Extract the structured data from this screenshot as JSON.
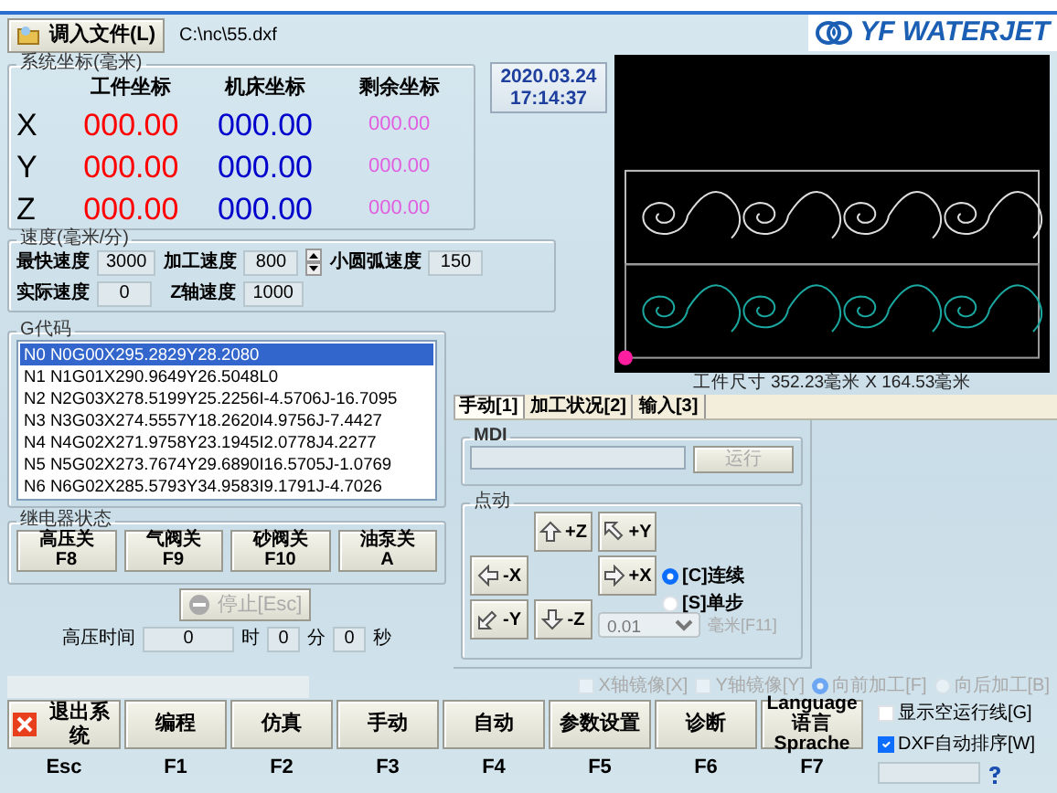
{
  "toolbar": {
    "load_button": "调入文件(L)",
    "file_path": "C:\\nc\\55.dxf"
  },
  "logo": {
    "text": "YF WATERJET"
  },
  "coordinates": {
    "title": "系统坐标(毫米)",
    "columns": [
      "工件坐标",
      "机床坐标",
      "剩余坐标"
    ],
    "rows": [
      {
        "axis": "X",
        "values": [
          "000.00",
          "000.00",
          "000.00"
        ]
      },
      {
        "axis": "Y",
        "values": [
          "000.00",
          "000.00",
          "000.00"
        ]
      },
      {
        "axis": "Z",
        "values": [
          "000.00",
          "000.00",
          "000.00"
        ]
      }
    ]
  },
  "datetime": {
    "date": "2020.03.24",
    "time": "17:14:37"
  },
  "preview": {
    "caption": "工件尺寸 352.23毫米 X 164.53毫米"
  },
  "speed": {
    "title": "速度(毫米/分)",
    "fields": [
      {
        "label": "最快速度",
        "value": "3000",
        "kind": "field"
      },
      {
        "label": "加工速度",
        "value": "800",
        "kind": "spinner"
      },
      {
        "label": "小圆弧速度",
        "value": "150",
        "kind": "field"
      },
      {
        "label": "实际速度",
        "value": "0",
        "kind": "field"
      },
      {
        "label": "Z轴速度",
        "value": "1000",
        "kind": "field"
      }
    ]
  },
  "gcode": {
    "title": "G代码",
    "lines": [
      {
        "text": "N0 N0G00X295.2829Y28.2080",
        "selected": true
      },
      {
        "text": "N1 N1G01X290.9649Y26.5048L0",
        "selected": false
      },
      {
        "text": "N2 N2G03X278.5199Y25.2256I-4.5706J-16.7095",
        "selected": false
      },
      {
        "text": "N3 N3G03X274.5557Y18.2620I4.9756J-7.4427",
        "selected": false
      },
      {
        "text": "N4 N4G02X271.9758Y23.1945I2.0778J4.2277",
        "selected": false
      },
      {
        "text": "N5 N5G02X273.7674Y29.6890I16.5705J-1.0769",
        "selected": false
      },
      {
        "text": "N6 N6G02X285.5793Y34.9583I9.1791J-4.7026",
        "selected": false
      }
    ]
  },
  "relays": {
    "title": "继电器状态",
    "buttons": [
      {
        "label": "高压关",
        "key": "F8"
      },
      {
        "label": "气阀关",
        "key": "F9"
      },
      {
        "label": "砂阀关",
        "key": "F10"
      },
      {
        "label": "油泵关",
        "key": "A"
      }
    ]
  },
  "stop_button": {
    "label": "停止[Esc]",
    "disabled": true
  },
  "pressure_time": {
    "label": "高压时间",
    "hours": "0",
    "hour_unit": "时",
    "minutes": "0",
    "minute_unit": "分",
    "seconds": "0",
    "second_unit": "秒"
  },
  "tabs": [
    {
      "label": "手动[1]",
      "selected": true
    },
    {
      "label": "加工状况[2]",
      "selected": false
    },
    {
      "label": "输入[3]",
      "selected": false
    }
  ],
  "mdi": {
    "title": "MDI",
    "run_button": "运行",
    "run_disabled": true
  },
  "jog": {
    "title": "点动",
    "buttons": [
      "+Z",
      "+Y",
      "-X",
      "+X",
      "-Y",
      "-Z"
    ],
    "modes": [
      {
        "label": "[C]连续",
        "selected": true
      },
      {
        "label": "[S]单步",
        "selected": false
      }
    ],
    "step": {
      "value": "0.01",
      "disabled": true
    },
    "unit": "毫米[F11]"
  },
  "options": [
    {
      "kind": "checkbox",
      "label": "X轴镜像[X]",
      "checked": false,
      "disabled": true
    },
    {
      "kind": "checkbox",
      "label": "Y轴镜像[Y]",
      "checked": false,
      "disabled": true
    },
    {
      "kind": "radio",
      "label": "向前加工[F]",
      "selected": true,
      "disabled": true
    },
    {
      "kind": "radio",
      "label": "向后加工[B]",
      "selected": false,
      "disabled": true
    }
  ],
  "side_options": [
    {
      "label": "显示空运行线[G]",
      "checked": false
    },
    {
      "label": "DXF自动排序[W]",
      "checked": true
    }
  ],
  "function_keys": [
    {
      "kind": "exit",
      "label": "退出系统",
      "key": "Esc"
    },
    {
      "kind": "plain",
      "label": "编程",
      "key": "F1"
    },
    {
      "kind": "plain",
      "label": "仿真",
      "key": "F2"
    },
    {
      "kind": "plain",
      "label": "手动",
      "key": "F3"
    },
    {
      "kind": "plain",
      "label": "自动",
      "key": "F4"
    },
    {
      "kind": "plain",
      "label": "参数设置",
      "key": "F5"
    },
    {
      "kind": "plain",
      "label": "诊断",
      "key": "F6"
    },
    {
      "kind": "plain",
      "label": "Language\n语言Sprache",
      "key": "F7"
    }
  ]
}
